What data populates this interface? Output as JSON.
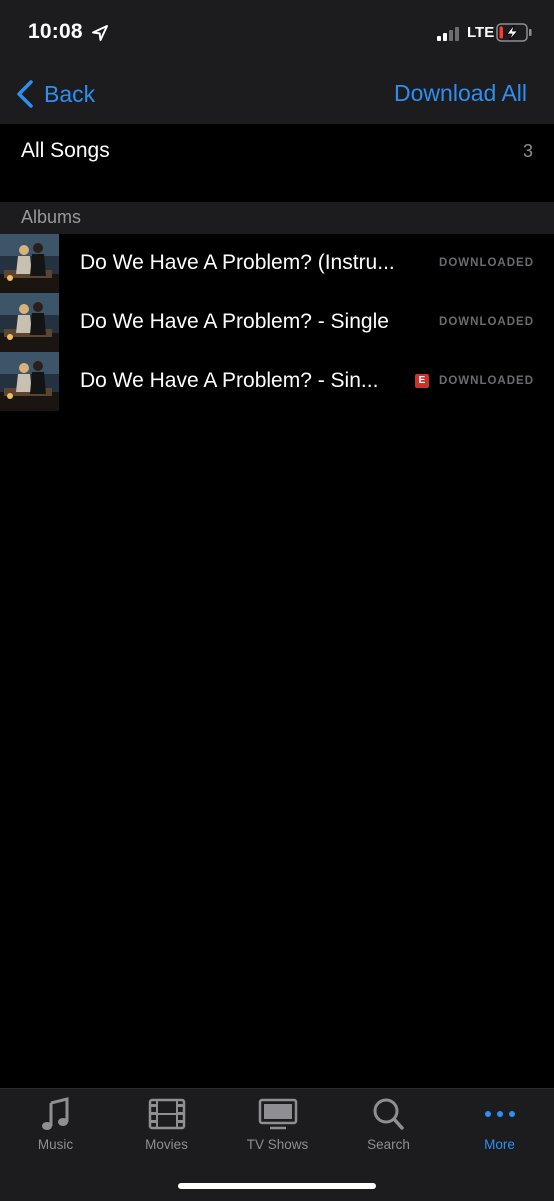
{
  "status_bar": {
    "time": "10:08",
    "network": "LTE",
    "icons": [
      "location-arrow-icon",
      "signal-icon",
      "battery-charging-icon"
    ]
  },
  "nav": {
    "back_label": "Back",
    "action_label": "Download All"
  },
  "all_songs": {
    "label": "All Songs",
    "count": "3"
  },
  "albums_section": {
    "title": "Albums",
    "items": [
      {
        "title": "Do We Have A Problem? (Instru...",
        "explicit": false,
        "status": "DOWNLOADED"
      },
      {
        "title": "Do We Have A Problem? - Single",
        "explicit": false,
        "status": "DOWNLOADED"
      },
      {
        "title": "Do We Have A Problem? - Sin...",
        "explicit": true,
        "explicit_label": "E",
        "status": "DOWNLOADED"
      }
    ]
  },
  "tab_bar": {
    "tabs": [
      {
        "label": "Music",
        "icon": "music-note-icon",
        "active": false
      },
      {
        "label": "Movies",
        "icon": "film-icon",
        "active": false
      },
      {
        "label": "TV Shows",
        "icon": "tv-icon",
        "active": false
      },
      {
        "label": "Search",
        "icon": "search-icon",
        "active": false
      },
      {
        "label": "More",
        "icon": "more-dots-icon",
        "active": true
      }
    ]
  },
  "colors": {
    "accent": "#2f8ff0",
    "explicit_badge": "#c8332b",
    "bar_background": "#1c1c1e",
    "background": "#000000"
  }
}
